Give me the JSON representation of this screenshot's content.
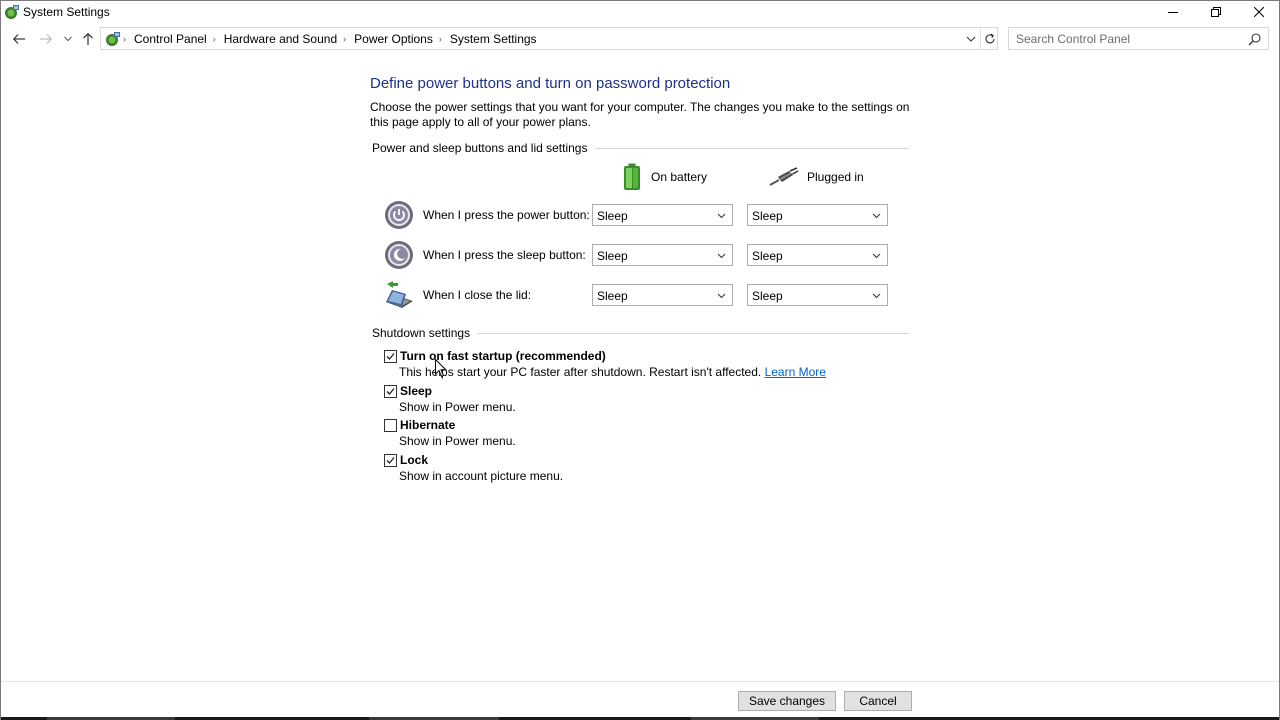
{
  "window": {
    "title": "System Settings"
  },
  "address_bar": {
    "breadcrumbs": [
      "Control Panel",
      "Hardware and Sound",
      "Power Options",
      "System Settings"
    ],
    "search_placeholder": "Search Control Panel"
  },
  "page": {
    "title": "Define power buttons and turn on password protection",
    "intro": "Choose the power settings that you want for your computer. The changes you make to the settings on this page apply to all of your power plans."
  },
  "power_section": {
    "heading": "Power and sleep buttons and lid settings",
    "columns": {
      "battery": "On battery",
      "plugged": "Plugged in"
    },
    "rows": [
      {
        "label": "When I press the power button:",
        "icon": "power-button-icon",
        "battery": "Sleep",
        "plugged": "Sleep"
      },
      {
        "label": "When I press the sleep button:",
        "icon": "sleep-button-icon",
        "battery": "Sleep",
        "plugged": "Sleep"
      },
      {
        "label": "When I close the lid:",
        "icon": "laptop-lid-icon",
        "battery": "Sleep",
        "plugged": "Sleep"
      }
    ]
  },
  "shutdown_section": {
    "heading": "Shutdown settings",
    "options": [
      {
        "label": "Turn on fast startup (recommended)",
        "desc": "This helps start your PC faster after shutdown. Restart isn't affected.",
        "link": "Learn More",
        "checked": true
      },
      {
        "label": "Sleep",
        "desc": "Show in Power menu.",
        "checked": true
      },
      {
        "label": "Hibernate",
        "desc": "Show in Power menu.",
        "checked": false
      },
      {
        "label": "Lock",
        "desc": "Show in account picture menu.",
        "checked": true
      }
    ]
  },
  "footer": {
    "save_label": "Save changes",
    "cancel_label": "Cancel"
  },
  "colors": {
    "title_blue": "#1e3287",
    "link_blue": "#0066cc",
    "button_bg": "#e1e1e1"
  }
}
